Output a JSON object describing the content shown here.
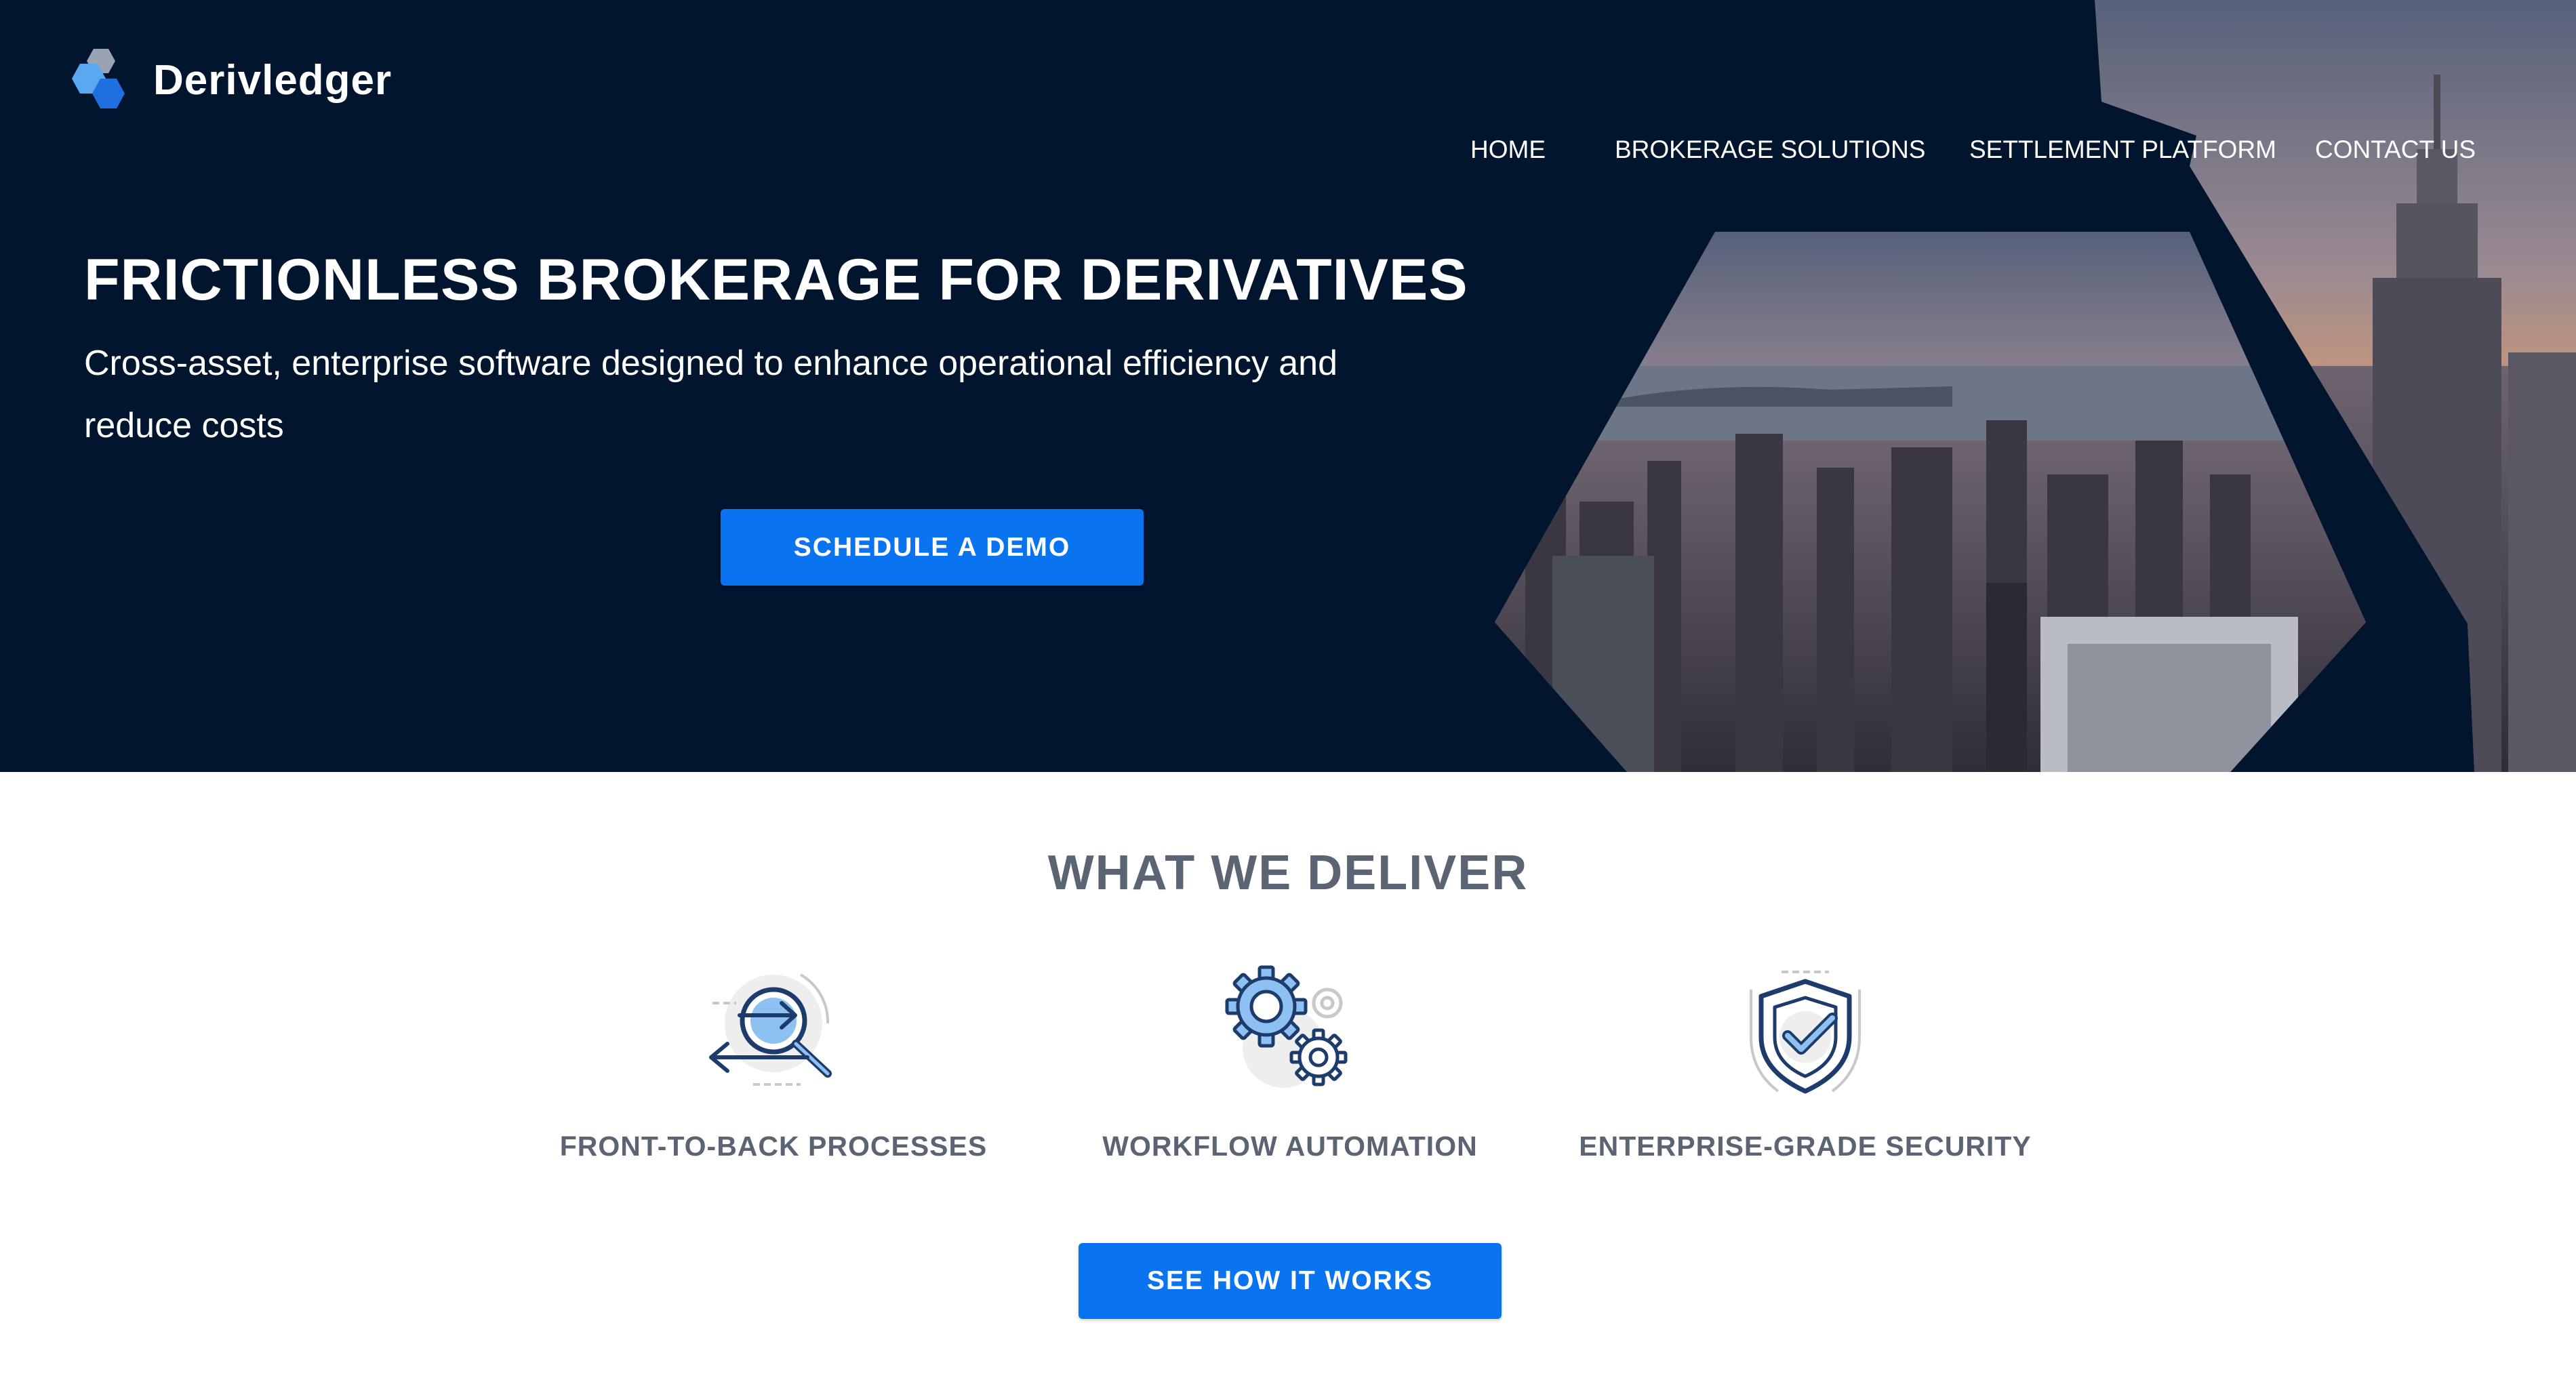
{
  "brand": {
    "name": "Derivledger"
  },
  "nav": {
    "items": [
      {
        "label": "HOME"
      },
      {
        "label": "BROKERAGE SOLUTIONS"
      },
      {
        "label": "SETTLEMENT PLATFORM"
      },
      {
        "label": "CONTACT US"
      }
    ]
  },
  "hero": {
    "title": "FRICTIONLESS BROKERAGE FOR DERIVATIVES",
    "subtitle": "Cross-asset, enterprise software designed to enhance operational efficiency and reduce costs",
    "cta_label": "SCHEDULE A DEMO",
    "image": "city-skyline-hexagon-photo"
  },
  "deliver": {
    "title": "WHAT WE DELIVER",
    "features": [
      {
        "label": "FRONT-TO-BACK PROCESSES",
        "icon": "magnifier-arrows-icon"
      },
      {
        "label": "WORKFLOW AUTOMATION",
        "icon": "gears-icon"
      },
      {
        "label": "ENTERPRISE-GRADE SECURITY",
        "icon": "shield-check-icon"
      }
    ],
    "cta_label": "SEE HOW IT WORKS"
  },
  "colors": {
    "hero_background": "#01162e",
    "accent": "#0a74f0",
    "heading_gray": "#5b6472",
    "icon_blue": "#8cc1f2",
    "icon_navy": "#1d3b6b"
  }
}
